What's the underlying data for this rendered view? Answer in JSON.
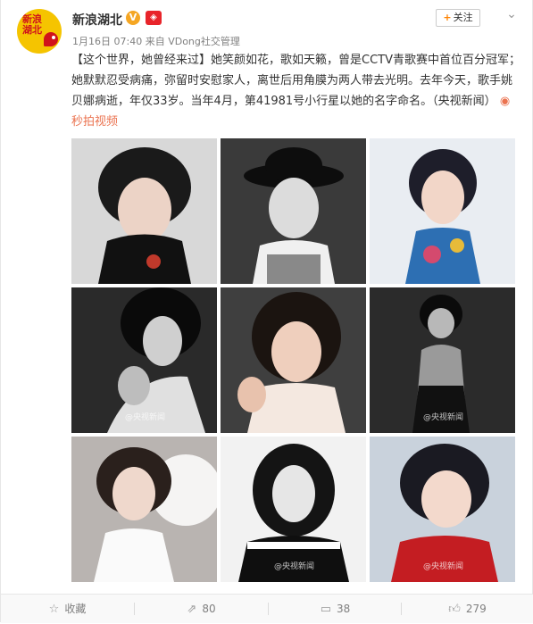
{
  "post": {
    "author": "新浪湖北",
    "avatar_text": "新浪湖北",
    "verified_badge": "V",
    "time": "1月16日 07:40",
    "source_prefix": "来自",
    "source": "VDong社交管理",
    "follow_label": "关注",
    "more_icon": "chevron-down-icon",
    "text_tag": "【这个世界，她曾经来过】",
    "text_body": "她笑颜如花，歌如天籁，曾是CCTV青歌赛中首位百分冠军；她默默忍受病痛，弥留时安慰家人，离世后用角膜为两人带去光明。去年今天，歌手姚贝娜病逝，年仅33岁。当年4月，第41981号小行星以她的名字命名。（央视新闻）",
    "video_link": "秒拍视频",
    "watermarks": [
      "@央视新闻",
      "@央视新闻",
      "@央视新闻",
      "@央视新闻",
      "@央视新闻"
    ]
  },
  "images": [
    {
      "label": "photo-1",
      "tone": "color"
    },
    {
      "label": "photo-2",
      "tone": "bw"
    },
    {
      "label": "photo-3",
      "tone": "color"
    },
    {
      "label": "photo-4",
      "tone": "bw"
    },
    {
      "label": "photo-5",
      "tone": "color"
    },
    {
      "label": "photo-6",
      "tone": "bw"
    },
    {
      "label": "photo-7",
      "tone": "color"
    },
    {
      "label": "photo-8",
      "tone": "bw"
    },
    {
      "label": "photo-9",
      "tone": "color"
    }
  ],
  "footer": {
    "favorite_label": "收藏",
    "repost_count": "80",
    "comment_count": "38",
    "like_count": "279"
  },
  "colors": {
    "link": "#eb7350",
    "accent_orange": "#ff8200",
    "text": "#333333",
    "meta": "#808080"
  }
}
